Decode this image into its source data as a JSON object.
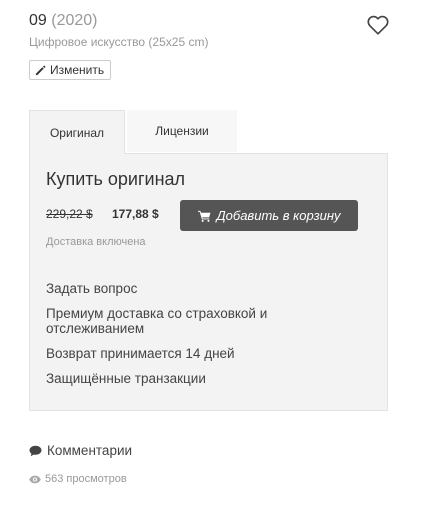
{
  "artwork": {
    "title": "09",
    "year": "(2020)",
    "subtitle": "Цифровое искусство (25x25 cm)",
    "edit_label": "Изменить"
  },
  "tabs": [
    {
      "label": "Оригинал",
      "active": true
    },
    {
      "label": "Лицензии",
      "active": false
    }
  ],
  "purchase": {
    "heading": "Купить оригинал",
    "old_price": "229,22 $",
    "new_price": "177,88 $",
    "add_to_cart_label": "Добавить в корзину",
    "delivery_note": "Доставка включена"
  },
  "features": [
    "Задать вопрос",
    "Премиум доставка со страховкой и отслеживанием",
    "Возврат принимается 14 дней",
    "Защищённые транзакции"
  ],
  "footer": {
    "comments_label": "Комментарии",
    "views_label": "563 просмотров"
  },
  "icons": [
    "heart-icon",
    "pencil-icon",
    "cart-icon",
    "comment-icon",
    "eye-icon"
  ],
  "colors": {
    "cart_button": "#555555",
    "panel_bg": "#f3f3f3",
    "muted_text": "#999999"
  }
}
